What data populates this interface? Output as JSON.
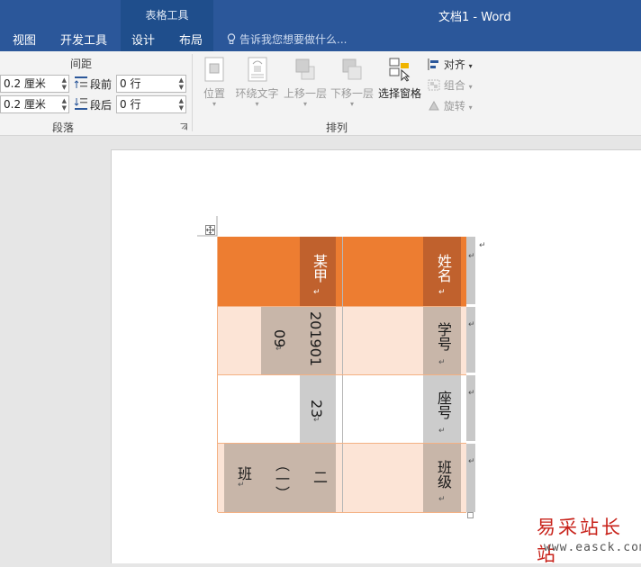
{
  "window": {
    "title": "文档1 - Word",
    "context_group": "表格工具"
  },
  "tabs": [
    {
      "label": "视图"
    },
    {
      "label": "开发工具"
    },
    {
      "label": "设计"
    },
    {
      "label": "布局"
    }
  ],
  "tell_me": {
    "placeholder": "告诉我您想要做什么...",
    "icon": "lightbulb-icon"
  },
  "paragraph": {
    "group_label": "段落",
    "spacing_label": "间距",
    "indent_left": "0.2 厘米",
    "indent_right": "0.2 厘米",
    "before_label": "段前",
    "before_value": "0 行",
    "after_label": "段后",
    "after_value": "0 行"
  },
  "arrange": {
    "group_label": "排列",
    "position": "位置",
    "wrap_text": "环绕文字",
    "bring_forward": "上移一层",
    "send_backward": "下移一层",
    "selection_pane": "选择窗格",
    "align": "对齐",
    "group": "组合",
    "rotate": "旋转"
  },
  "table": {
    "rows": [
      {
        "label": "姓名",
        "value": [
          "某甲"
        ]
      },
      {
        "label": "学号",
        "value": [
          "201901",
          "09"
        ]
      },
      {
        "label": "座号",
        "value": [
          "23"
        ]
      },
      {
        "label": "班级",
        "value": [
          "二",
          "（一）",
          "班"
        ]
      }
    ],
    "colors": {
      "header": "#ed7d31",
      "header_dark": "#c0612d",
      "light": "#fce4d6",
      "gray": "#c8b6a9",
      "gray2": "#cccccc"
    }
  },
  "watermark": {
    "text": "易采站长站",
    "url": "www.easck.com"
  }
}
